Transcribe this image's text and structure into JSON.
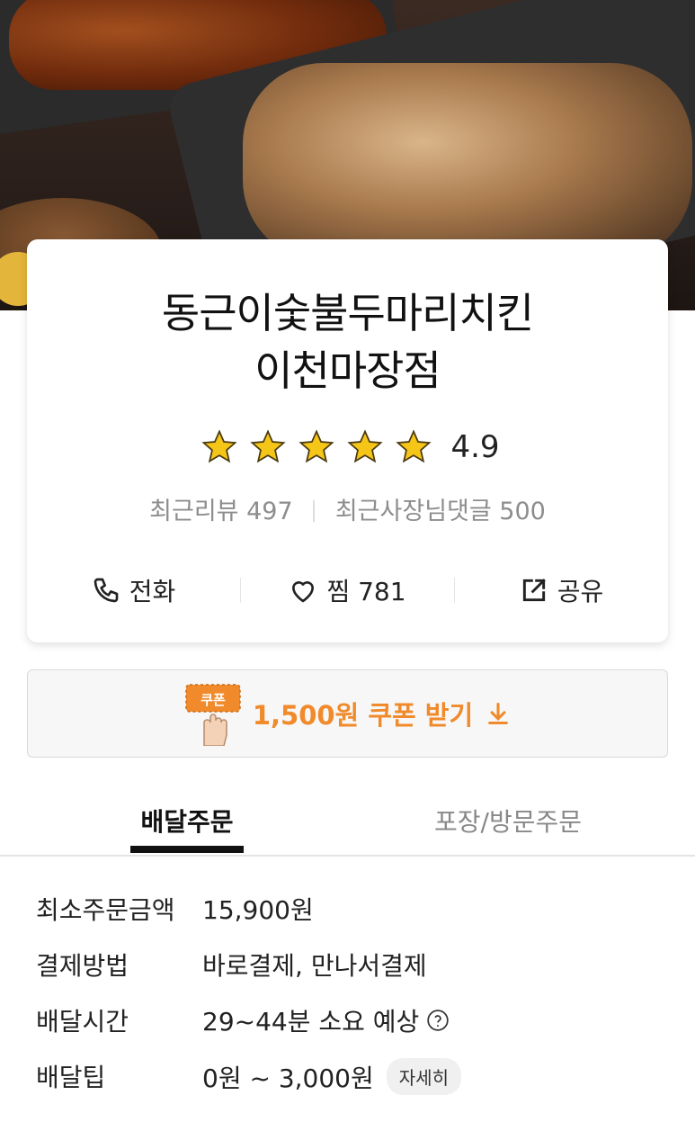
{
  "store": {
    "name_line1": "동근이숯불두마리치킨",
    "name_line2": "이천마장점",
    "rating": "4.9",
    "stars": 5,
    "recent_reviews": "최근리뷰 497",
    "owner_replies": "최근사장님댓글 500"
  },
  "actions": {
    "call": "전화",
    "favorite": "찜 781",
    "share": "공유"
  },
  "coupon": {
    "badge": "쿠폰",
    "text": "1,500원 쿠폰 받기"
  },
  "tabs": {
    "delivery": "배달주문",
    "pickup": "포장/방문주문"
  },
  "info": {
    "min_order_label": "최소주문금액",
    "min_order_value": "15,900원",
    "payment_label": "결제방법",
    "payment_value": "바로결제, 만나서결제",
    "time_label": "배달시간",
    "time_value": "29~44분 소요 예상",
    "tip_label": "배달팁",
    "tip_value": "0원 ~ 3,000원",
    "tip_detail": "자세히"
  },
  "colors": {
    "accent": "#f08a2b",
    "star": "#f5c518"
  }
}
